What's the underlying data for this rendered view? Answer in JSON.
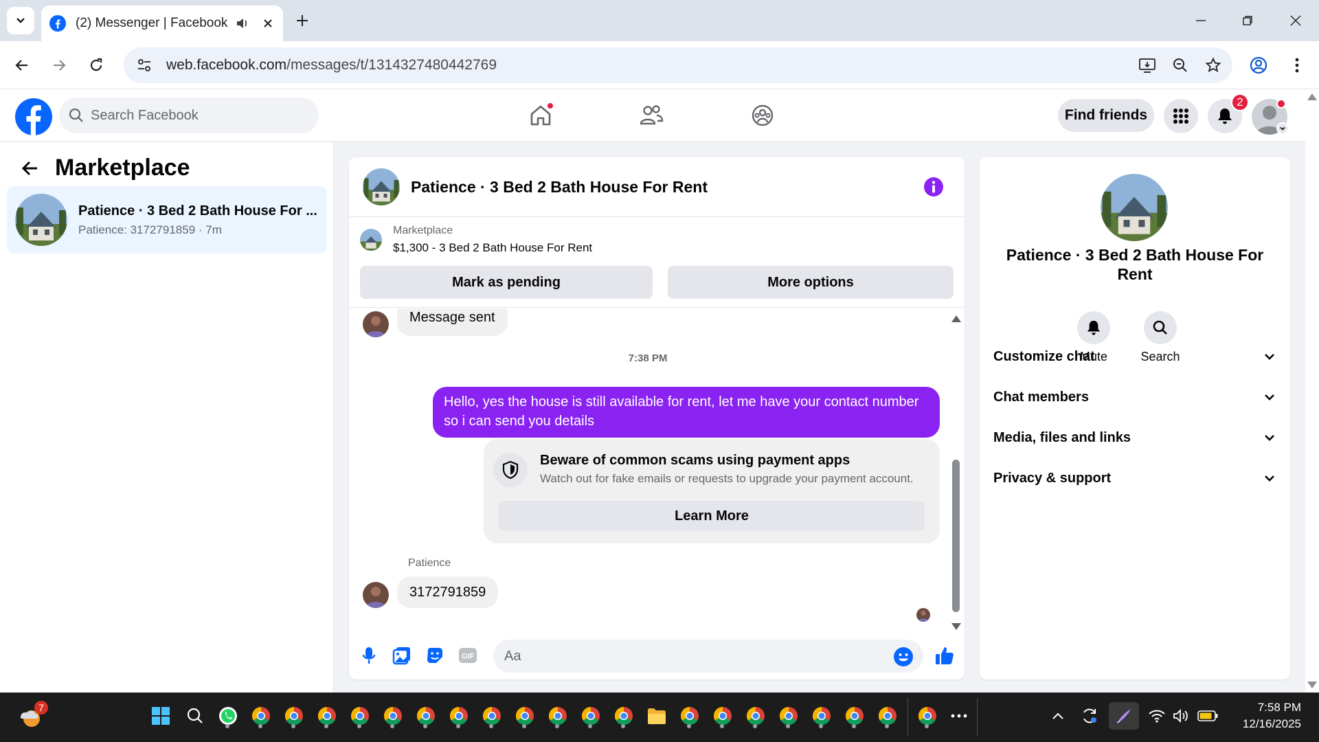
{
  "browser": {
    "tab_title": "(2) Messenger | Facebook",
    "url_host": "web.facebook.com",
    "url_path": "/messages/t/1314327480442769"
  },
  "fb": {
    "search_placeholder": "Search Facebook",
    "find_friends_label": "Find friends",
    "notification_count": "2",
    "brand_color": "#0866ff"
  },
  "sidebar": {
    "title": "Marketplace",
    "conversations": [
      {
        "name": "Patience · 3 Bed 2 Bath House For ...",
        "preview": "Patience: 3172791859 · 7m"
      }
    ]
  },
  "chat": {
    "title": "Patience · 3 Bed 2 Bath House For Rent",
    "marketplace_label": "Marketplace",
    "listing": "$1,300 - 3 Bed 2 Bath House For Rent",
    "mark_pending_label": "Mark as pending",
    "more_options_label": "More options",
    "messages": {
      "prev_incoming": "Message sent",
      "timestamp": "7:38 PM",
      "outgoing": "Hello, yes the house is still available for rent, let me have your contact number so i can send you  details",
      "scam_title": "Beware of common scams using payment apps",
      "scam_desc": "Watch out for fake emails or requests to upgrade your payment account.",
      "learn_more_label": "Learn More",
      "sender_name": "Patience",
      "incoming": "3172791859"
    },
    "composer_placeholder": "Aa",
    "accent_color": "#8a23f2"
  },
  "info_panel": {
    "name": "Patience · 3 Bed 2 Bath House For Rent",
    "actions": [
      {
        "label": "Mute",
        "icon": "bell-icon"
      },
      {
        "label": "Search",
        "icon": "search-icon"
      }
    ],
    "sections": [
      "Customize chat",
      "Chat members",
      "Media, files and links",
      "Privacy & support"
    ]
  },
  "taskbar": {
    "weather_badge": "7",
    "time": "7:58 PM",
    "date": "12/16/2025"
  }
}
